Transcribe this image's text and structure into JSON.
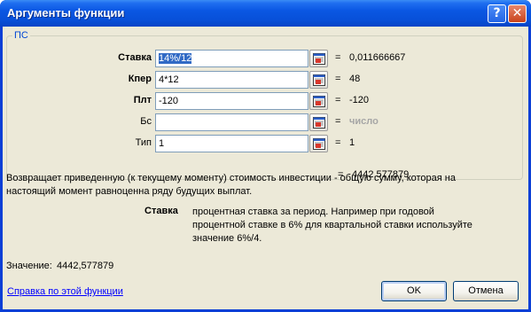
{
  "window": {
    "title": "Аргументы функции",
    "help_btn": "?",
    "close_btn": "✕"
  },
  "function": {
    "name": "ПС",
    "args": [
      {
        "label": "Ставка",
        "bold": true,
        "input": "14%/12",
        "selected": true,
        "result": "0,011666667",
        "hint": false
      },
      {
        "label": "Кпер",
        "bold": true,
        "input": "4*12",
        "selected": false,
        "result": "48",
        "hint": false
      },
      {
        "label": "Плт",
        "bold": true,
        "input": "-120",
        "selected": false,
        "result": "-120",
        "hint": false
      },
      {
        "label": "Бс",
        "bold": false,
        "input": "",
        "selected": false,
        "result": "число",
        "hint": true
      },
      {
        "label": "Тип",
        "bold": false,
        "input": "1",
        "selected": false,
        "result": "1",
        "hint": false
      }
    ],
    "eq": "=",
    "result": "4442,577879",
    "description": "Возвращает приведенную (к текущему моменту) стоимость инвестиции - общую сумму, которая на настоящий момент равноценна ряду будущих выплат.",
    "arg_help_name": "Ставка",
    "arg_help_text": "процентная ставка за период. Например при годовой процентной ставке в 6% для квартальной ставки используйте значение 6%/4."
  },
  "footer": {
    "value_label": "Значение:",
    "value": "4442,577879",
    "help_link": "Справка по этой функции",
    "ok_label": "OK",
    "cancel_label": "Отмена"
  },
  "icons": {
    "collapse": "collapse-dialog-icon"
  }
}
